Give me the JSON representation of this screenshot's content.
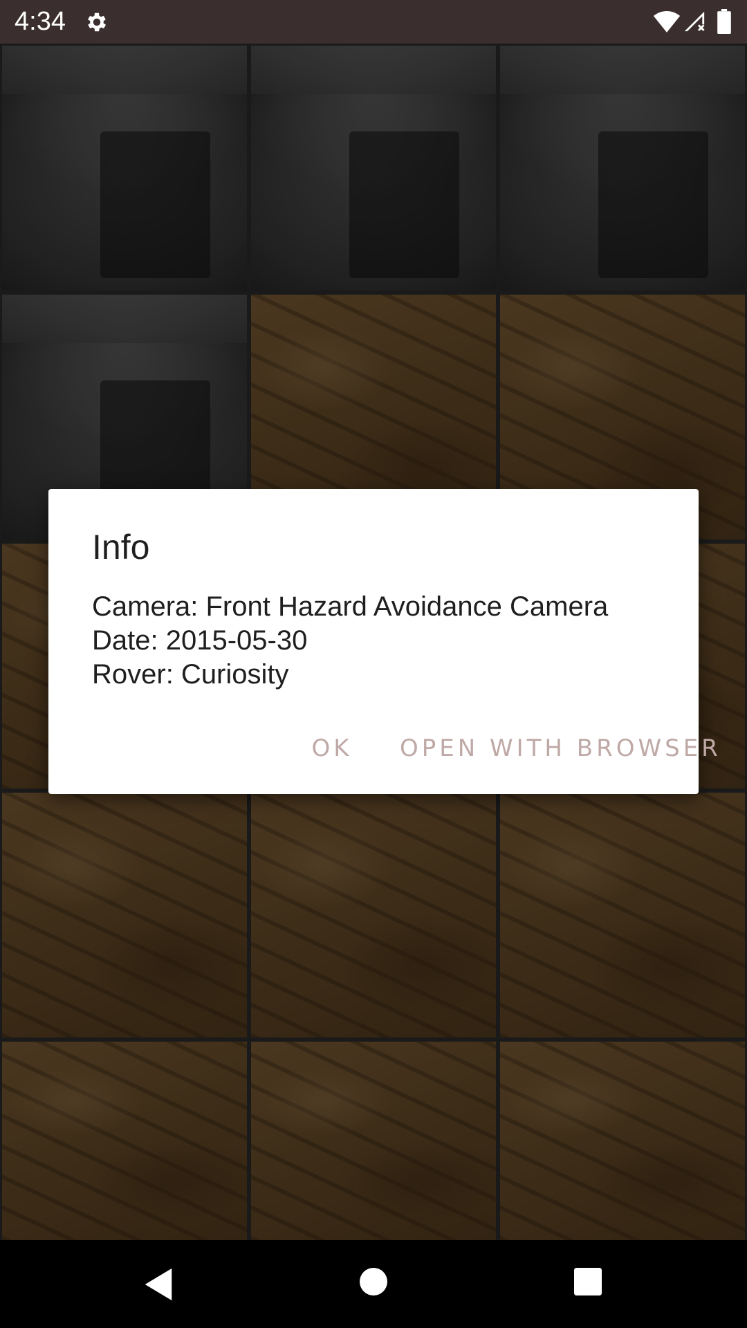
{
  "status_bar": {
    "time": "4:34",
    "icons": [
      "settings-gear-icon",
      "wifi-icon",
      "signal-icon",
      "battery-icon"
    ]
  },
  "photo_grid": {
    "tiles": [
      {
        "type": "hazcam-grayscale"
      },
      {
        "type": "hazcam-grayscale"
      },
      {
        "type": "hazcam-grayscale"
      },
      {
        "type": "hazcam-grayscale"
      },
      {
        "type": "mars-terrain-color"
      },
      {
        "type": "mars-terrain-color"
      },
      {
        "type": "mars-terrain-color"
      },
      {
        "type": "mars-terrain-color"
      },
      {
        "type": "mars-terrain-color"
      },
      {
        "type": "mars-terrain-color"
      },
      {
        "type": "mars-terrain-color"
      },
      {
        "type": "mars-terrain-color"
      },
      {
        "type": "mars-terrain-color"
      },
      {
        "type": "mars-terrain-color"
      },
      {
        "type": "mars-terrain-color"
      }
    ]
  },
  "dialog": {
    "title": "Info",
    "lines": {
      "camera": "Camera: Front Hazard Avoidance Camera",
      "date": "Date: 2015-05-30",
      "rover": "Rover: Curiosity"
    },
    "buttons": {
      "ok": "OK",
      "open_with_browser": "OPEN WITH BROWSER"
    }
  },
  "nav_bar": {
    "icons": [
      "back-icon",
      "home-icon",
      "recents-icon"
    ]
  },
  "colors": {
    "status_bar_bg": "#3a2f2e",
    "dialog_bg": "#ffffff",
    "dialog_button_text": "#bfa9a7",
    "nav_bar_bg": "#000000"
  }
}
